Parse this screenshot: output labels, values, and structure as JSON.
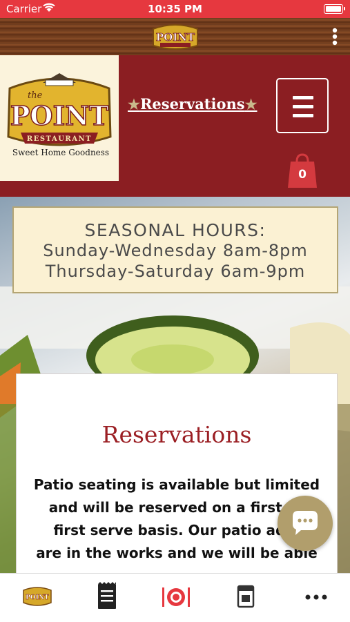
{
  "status_bar": {
    "carrier": "Carrier",
    "time": "10:35 PM"
  },
  "header": {
    "logo_text": {
      "top": "the",
      "main": "POINT",
      "band": "RESTAURANT",
      "tagline": "Sweet Home Goodness"
    },
    "reservations_link": "Reservations",
    "cart_count": "0"
  },
  "hours": {
    "title": "SEASONAL HOURS:",
    "line1": "Sunday-Wednesday 8am-8pm",
    "line2": "Thursday-Saturday 6am-9pm"
  },
  "reservations": {
    "title": "Reservations",
    "body_lines": [
      "Patio seating is available but limited",
      "and will be reserved on a first co",
      "first serve basis. Our patio addi",
      "are in the works and we will be able"
    ]
  },
  "tab_bar": {
    "items": [
      "home-logo-icon",
      "menu-list-icon",
      "dining-icon",
      "calendar-icon",
      "more-icon"
    ]
  },
  "colors": {
    "status_red": "#e6383f",
    "brand_red": "#8b1e22",
    "gold": "#b19e6c",
    "cream": "#fbf1d3"
  }
}
